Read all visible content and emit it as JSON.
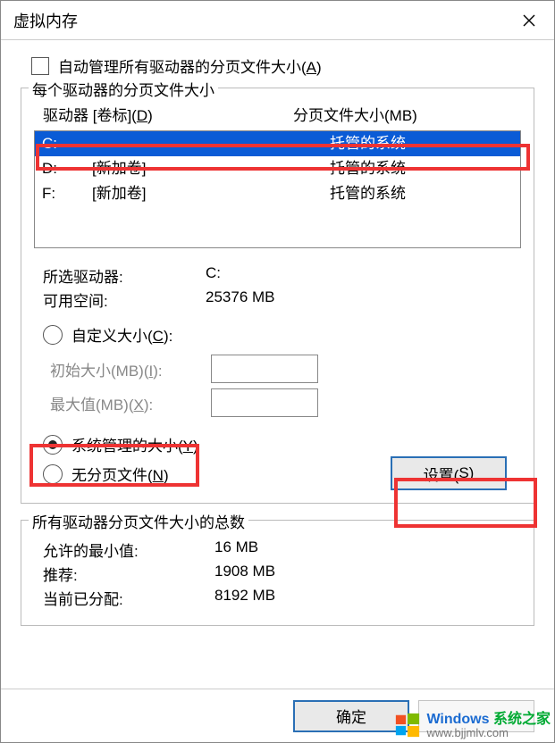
{
  "title": "虚拟内存",
  "auto_manage": "自动管理所有驱动器的分页文件大小(",
  "auto_manage_u": "A",
  "auto_manage_end": ")",
  "group1_label": "每个驱动器的分页文件大小",
  "drive_header": "驱动器 [卷标](",
  "drive_header_u": "D",
  "drive_header_end": ")",
  "page_header": "分页文件大小(MB)",
  "drives": [
    {
      "letter": "C:",
      "label": "",
      "status": "托管的系统",
      "selected": true
    },
    {
      "letter": "D:",
      "label": "[新加卷]",
      "status": "托管的系统",
      "selected": false
    },
    {
      "letter": "F:",
      "label": "[新加卷]",
      "status": "托管的系统",
      "selected": false
    }
  ],
  "selected_drive_label": "所选驱动器:",
  "selected_drive_value": "C:",
  "free_space_label": "可用空间:",
  "free_space_value": "25376 MB",
  "custom_size": "自定义大小(",
  "custom_size_u": "C",
  "custom_size_end": "):",
  "initial_size": "初始大小(MB)(",
  "initial_size_u": "I",
  "initial_size_end": "):",
  "max_size": "最大值(MB)(",
  "max_size_u": "X",
  "max_size_end": "):",
  "system_managed": "系统管理的大小(",
  "system_managed_u": "Y",
  "system_managed_end": ")",
  "no_paging": "无分页文件(",
  "no_paging_u": "N",
  "no_paging_end": ")",
  "set_btn": "设置(",
  "set_btn_u": "S",
  "set_btn_end": ")",
  "group2_label": "所有驱动器分页文件大小的总数",
  "min_allowed_label": "允许的最小值:",
  "min_allowed_value": "16 MB",
  "recommended_label": "推荐:",
  "recommended_value": "1908 MB",
  "current_label": "当前已分配:",
  "current_value": "8192 MB",
  "ok": "确定",
  "wm_top_a": "Windows",
  "wm_top_b": "系统之家",
  "wm_bot": "www.bjjmlv.com"
}
